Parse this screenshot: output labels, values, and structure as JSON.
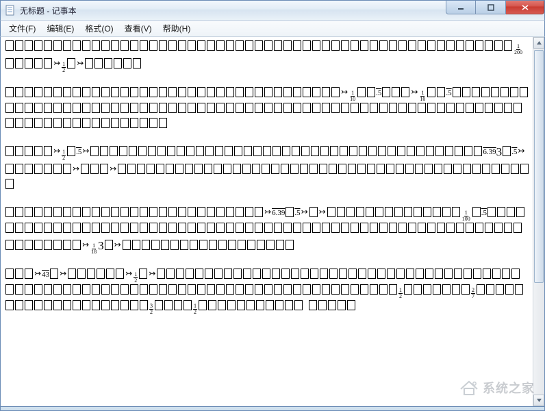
{
  "window": {
    "title": "无标题 - 记事本",
    "app_name": "记事本",
    "doc_name": "无标题"
  },
  "menu": {
    "items": [
      {
        "label": "文件(F)",
        "name": "menu-file"
      },
      {
        "label": "编辑(E)",
        "name": "menu-edit"
      },
      {
        "label": "格式(O)",
        "name": "menu-format"
      },
      {
        "label": "查看(V)",
        "name": "menu-view"
      },
      {
        "label": "帮助(H)",
        "name": "menu-help"
      }
    ]
  },
  "editor": {
    "paragraphs": [
      {
        "tokens": [
          {
            "t": "n",
            "c": 53
          },
          {
            "t": "frac",
            "n": "1",
            "d": "200"
          },
          {
            "t": "n",
            "c": 5
          },
          {
            "t": "sym",
            "v": "↣"
          },
          {
            "t": "frac",
            "n": "1",
            "d": "2"
          },
          {
            "t": "n",
            "c": 1
          },
          {
            "t": "sym",
            "v": "↣"
          },
          {
            "t": "n",
            "c": 6
          }
        ]
      },
      {
        "tokens": [
          {
            "t": "n",
            "c": 35
          },
          {
            "t": "sym",
            "v": "↣"
          },
          {
            "t": "frac",
            "n": "1",
            "d": "10"
          },
          {
            "t": "n",
            "c": 2
          },
          {
            "t": "ov",
            "v": ".5"
          },
          {
            "t": "n",
            "c": 3
          },
          {
            "t": "sym",
            "v": "↣"
          },
          {
            "t": "frac",
            "n": "1",
            "d": "10"
          },
          {
            "t": "n",
            "c": 2
          },
          {
            "t": "ov",
            "v": ".5"
          },
          {
            "t": "n",
            "c": 3
          },
          {
            "t": "n",
            "c": 53
          },
          {
            "t": "n",
            "c": 23
          }
        ]
      },
      {
        "tokens": [
          {
            "t": "n",
            "c": 5
          },
          {
            "t": "sym",
            "v": "↣"
          },
          {
            "t": "frac",
            "n": "1",
            "d": "2"
          },
          {
            "t": "n",
            "c": 1
          },
          {
            "t": "ov",
            "v": ".5"
          },
          {
            "t": "sym",
            "v": "↣"
          },
          {
            "t": "n",
            "c": 41
          },
          {
            "t": "ov",
            "v": "6.39"
          },
          {
            "t": "big",
            "v": "3"
          },
          {
            "t": "n",
            "c": 1
          },
          {
            "t": "ov",
            "v": ".5"
          },
          {
            "t": "sym",
            "v": "↣"
          },
          {
            "t": "n",
            "c": 7
          },
          {
            "t": "sym",
            "v": "↣"
          },
          {
            "t": "n",
            "c": 3
          },
          {
            "t": "sym",
            "v": "↣"
          },
          {
            "t": "n",
            "c": 37
          },
          {
            "t": "n",
            "c": 7
          }
        ]
      },
      {
        "tokens": [
          {
            "t": "n",
            "c": 27
          },
          {
            "t": "sym",
            "v": "↣"
          },
          {
            "t": "ov",
            "v": "6.39"
          },
          {
            "t": "n",
            "c": 1
          },
          {
            "t": "ov",
            "v": ".5"
          },
          {
            "t": "sym",
            "v": "↣"
          },
          {
            "t": "n",
            "c": 1
          },
          {
            "t": "sym",
            "v": "↣"
          },
          {
            "t": "n",
            "c": 14
          },
          {
            "t": "frac",
            "n": "1",
            "d": "100"
          },
          {
            "t": "n",
            "c": 1
          },
          {
            "t": "ov",
            "v": ".5"
          },
          {
            "t": "n",
            "c": 52
          },
          {
            "t": "n",
            "c": 14
          },
          {
            "t": "sym",
            "v": "↣"
          },
          {
            "t": "frac",
            "n": "1",
            "d": "18"
          },
          {
            "t": "big",
            "v": "3"
          },
          {
            "t": "n",
            "c": 1
          },
          {
            "t": "sym",
            "v": "↣"
          },
          {
            "t": "n",
            "c": 18
          }
        ]
      },
      {
        "tokens": [
          {
            "t": "n",
            "c": 3
          },
          {
            "t": "sym",
            "v": "↣"
          },
          {
            "t": "ov",
            "v": "43"
          },
          {
            "t": "n",
            "c": 1
          },
          {
            "t": "sym",
            "v": "↣"
          },
          {
            "t": "n",
            "c": 6
          },
          {
            "t": "sym",
            "v": "↣"
          },
          {
            "t": "frac",
            "n": "1",
            "d": "2"
          },
          {
            "t": "n",
            "c": 1
          },
          {
            "t": "sym",
            "v": "↣"
          },
          {
            "t": "n",
            "c": 37
          },
          {
            "t": "n",
            "c": 42
          },
          {
            "t": "frac",
            "n": "1",
            "d": "2"
          },
          {
            "t": "n",
            "c": 5
          },
          {
            "t": "n",
            "c": 2
          },
          {
            "t": "frac",
            "n": "2",
            "d": "7"
          },
          {
            "t": "n",
            "c": 20
          },
          {
            "t": "frac",
            "n": "3",
            "d": "2"
          },
          {
            "t": "n",
            "c": 4
          },
          {
            "t": "frac",
            "n": "1",
            "d": "2"
          },
          {
            "t": "n",
            "c": 11
          },
          {
            "t": "txt",
            "v": "  "
          },
          {
            "t": "n",
            "c": 5
          }
        ]
      }
    ]
  },
  "watermark": {
    "text": "系统之家"
  },
  "icons": {
    "minimize": "minimize-icon",
    "maximize": "maximize-icon",
    "close": "close-icon",
    "app": "notepad-icon",
    "scroll_up": "chevron-up-icon",
    "scroll_down": "chevron-down-icon"
  }
}
